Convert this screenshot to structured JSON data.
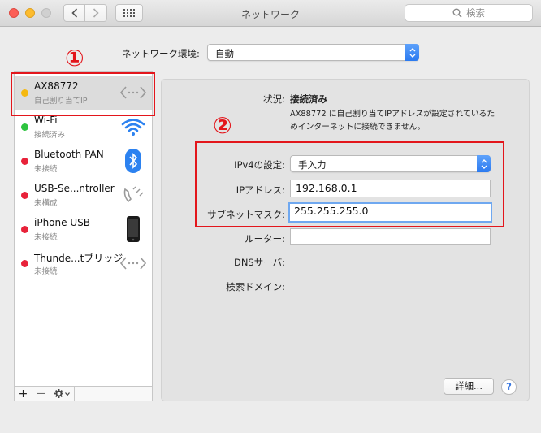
{
  "window": {
    "title": "ネットワーク"
  },
  "toolbar": {
    "search_placeholder": "検索"
  },
  "location": {
    "label": "ネットワーク環境:",
    "value": "自動"
  },
  "services": [
    {
      "name": "AX88772",
      "status": "自己割り当てIP",
      "status_color": "#f5b80f",
      "icon": "ethernet-arrows-icon",
      "selected": true
    },
    {
      "name": "Wi-Fi",
      "status": "接続済み",
      "status_color": "#2ec440",
      "icon": "wifi-icon"
    },
    {
      "name": "Bluetooth PAN",
      "status": "未接続",
      "status_color": "#e8223a",
      "icon": "bluetooth-icon"
    },
    {
      "name": "USB-Se...ntroller",
      "status": "未構成",
      "status_color": "#e8223a",
      "icon": "phone-handset-icon"
    },
    {
      "name": "iPhone USB",
      "status": "未接続",
      "status_color": "#e8223a",
      "icon": "iphone-icon"
    },
    {
      "name": "Thunde...tブリッジ",
      "status": "未接続",
      "status_color": "#e8223a",
      "icon": "ethernet-arrows-icon"
    }
  ],
  "sidebar_toolbar": {
    "add": "+",
    "remove": "—"
  },
  "detail": {
    "status_label": "状況:",
    "status_value": "接続済み",
    "status_description": "AX88772 に自己割り当てIPアドレスが設定されているためインターネットに接続できません。",
    "ipv4_label": "IPv4の設定:",
    "ipv4_value": "手入力",
    "ip_label": "IPアドレス:",
    "ip_value": "192.168.0.1",
    "subnet_label": "サブネットマスク:",
    "subnet_value": "255.255.255.0",
    "router_label": "ルーター:",
    "router_value": "",
    "dns_label": "DNSサーバ:",
    "search_domain_label": "検索ドメイン:",
    "advanced_button": "詳細...",
    "help": "?"
  },
  "annotations": {
    "marker1": "①",
    "marker2": "②"
  },
  "colors": {
    "annotation_red": "#e3161c",
    "accent_blue": "#2b7af0"
  }
}
